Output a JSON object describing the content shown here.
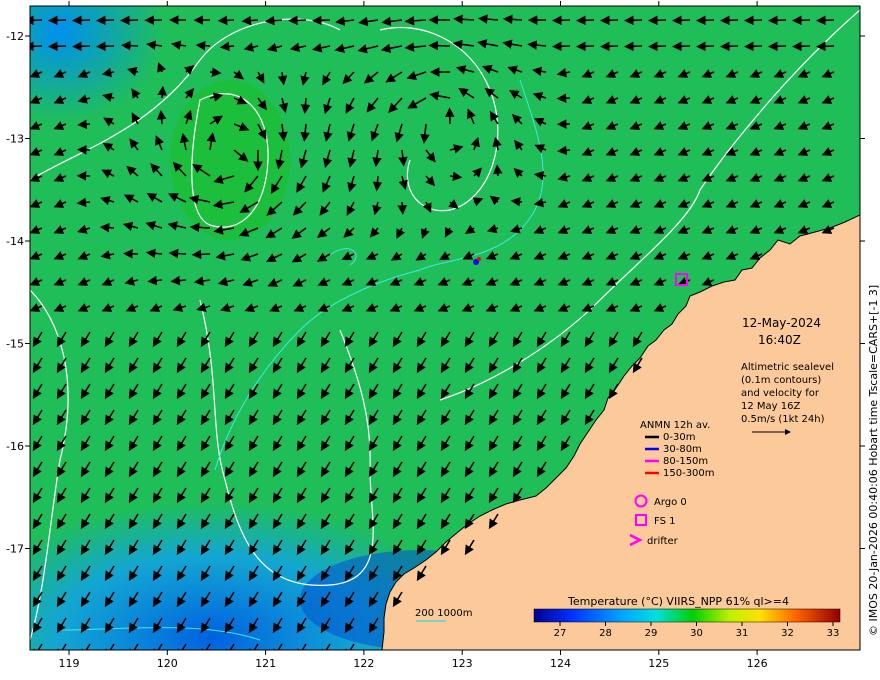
{
  "map": {
    "date": "12-May-2024",
    "time": "16:40Z",
    "description_lines": [
      "Altimetric sealevel",
      "(0.1m contours)",
      "and velocity for",
      "12 May 16Z",
      "0.5m/s (1kt 24h)"
    ],
    "anmn_legend": {
      "title": "ANMN 12h av.",
      "items": [
        {
          "label": "0-30m",
          "color": "#000000"
        },
        {
          "label": "30-80m",
          "color": "#0000ff"
        },
        {
          "label": "80-150m",
          "color": "#ff00ff"
        },
        {
          "label": "150-300m",
          "color": "#ff0000"
        }
      ]
    },
    "markers_legend": [
      {
        "label": "Argo 0",
        "icon": "circle-icon",
        "color": "#ff00ff"
      },
      {
        "label": "FS 1",
        "icon": "square-icon",
        "color": "#ff00ff"
      },
      {
        "label": "drifter",
        "icon": "chevron-icon",
        "color": "#ff00ff"
      }
    ],
    "depth_legend": {
      "label": "200  1000m",
      "color": "#00e0e0"
    },
    "colorbar": {
      "title": "Temperature (°C) VIIRS_NPP 61% ql>=4",
      "ticks": [
        "27",
        "28",
        "29",
        "30",
        "31",
        "32",
        "33"
      ]
    },
    "credit": "© IMOS 20-Jan-2026 00:40:06 Hobart time Tscale=CARS+[-1 3]",
    "x_ticks": [
      "119",
      "120",
      "121",
      "122",
      "123",
      "124",
      "125",
      "126"
    ],
    "y_ticks": [
      "-12",
      "-13",
      "-14",
      "-15",
      "-16",
      "-17"
    ],
    "colors": {
      "land": "#fcc99a",
      "ocean_green": "#20b020",
      "ocean_blue": "#1080f0",
      "contour": "#ffffff"
    }
  }
}
